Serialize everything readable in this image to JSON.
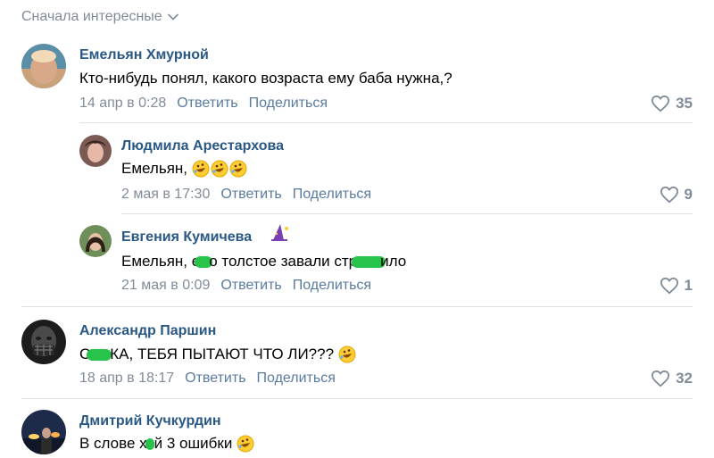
{
  "sort": {
    "label": "Сначала интересные"
  },
  "comments": [
    {
      "author": "Емельян Хмурной",
      "text": "Кто-нибудь понял, какого возраста ему баба нужна,?",
      "date": "14 апр в 0:28",
      "reply": "Ответить",
      "share": "Поделиться",
      "likes": "35"
    },
    {
      "author": "Людмила Арестархова",
      "text": "Емельян,",
      "date": "2 мая в 17:30",
      "reply": "Ответить",
      "share": "Поделиться",
      "likes": "9"
    },
    {
      "author": "Евгения Кумичева",
      "text_a": "Емельян, е",
      "text_b": "о толстое завали стр",
      "text_c": "ило",
      "date": "21 мая в 0:09",
      "reply": "Ответить",
      "share": "Поделиться",
      "likes": "1"
    },
    {
      "author": "Александр Паршин",
      "text_a": "С",
      "text_b": "КА, ТЕБЯ ПЫТАЮТ ЧТО ЛИ???",
      "date": "18 апр в 18:17",
      "reply": "Ответить",
      "share": "Поделиться",
      "likes": "32"
    },
    {
      "author": "Дмитрий Кучкурдин",
      "text_a": "В слове х",
      "text_b": "й 3 ошибки"
    }
  ],
  "colors": {
    "link": "#2a5885",
    "muted": "#818c99",
    "action": "#5a7ba0",
    "censor": "#27c34a"
  },
  "icons": {
    "like": "heart-outline-icon",
    "emoji": "rofl-emoji-icon",
    "sort": "chevron-down-icon"
  }
}
